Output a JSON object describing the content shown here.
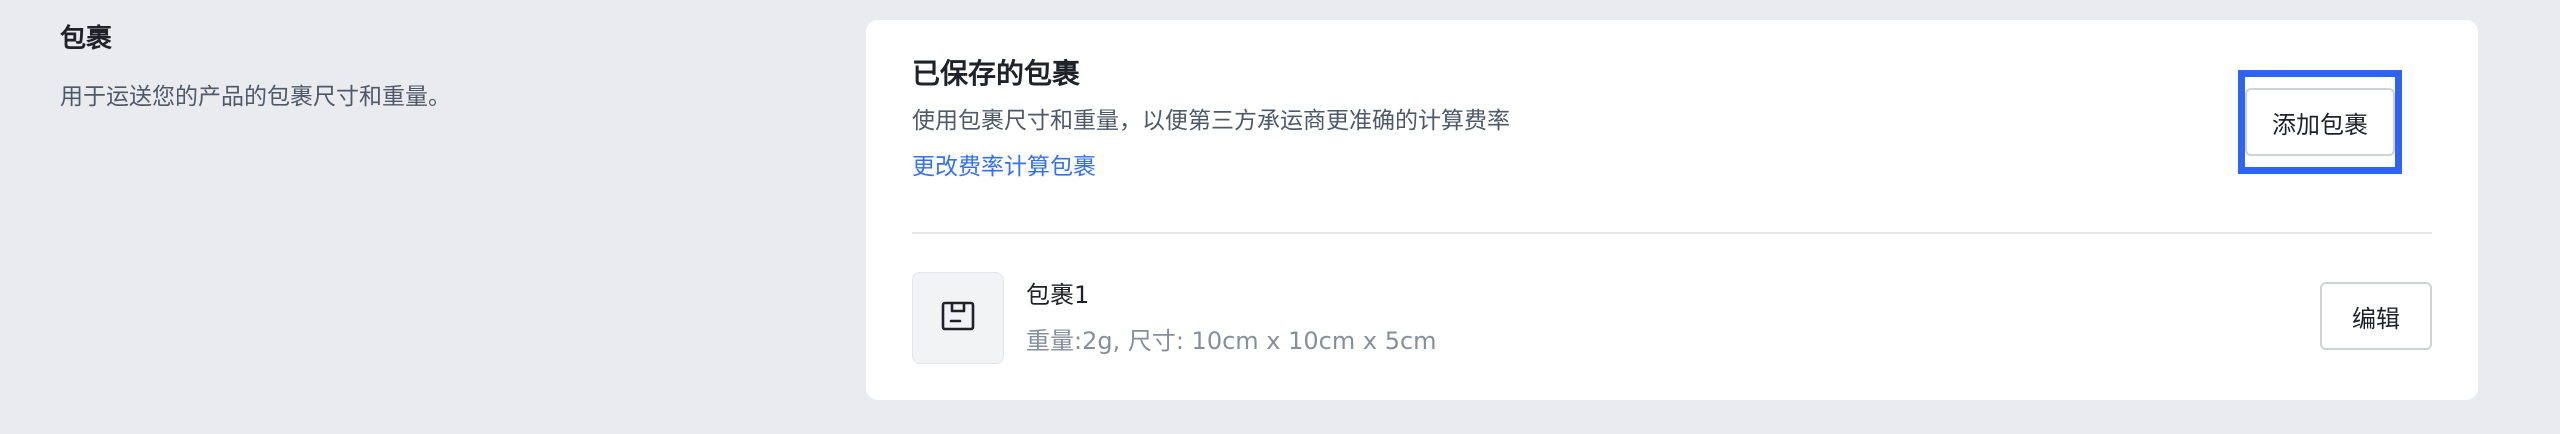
{
  "section": {
    "title": "包裹",
    "description": "用于运送您的产品的包裹尺寸和重量。"
  },
  "card": {
    "title": "已保存的包裹",
    "subtitle": "使用包裹尺寸和重量，以便第三方承运商更准确的计算费率",
    "link_label": "更改费率计算包裹",
    "add_button_label": "添加包裹",
    "packages": [
      {
        "name": "包裹1",
        "meta": "重量:2g, 尺寸: 10cm x 10cm x 5cm",
        "edit_label": "编辑",
        "icon": "package-box-icon"
      }
    ]
  },
  "colors": {
    "page_bg": "#E9EBEF",
    "card_bg": "#FFFFFF",
    "link": "#3370FF",
    "highlight": "#2F63F5"
  }
}
